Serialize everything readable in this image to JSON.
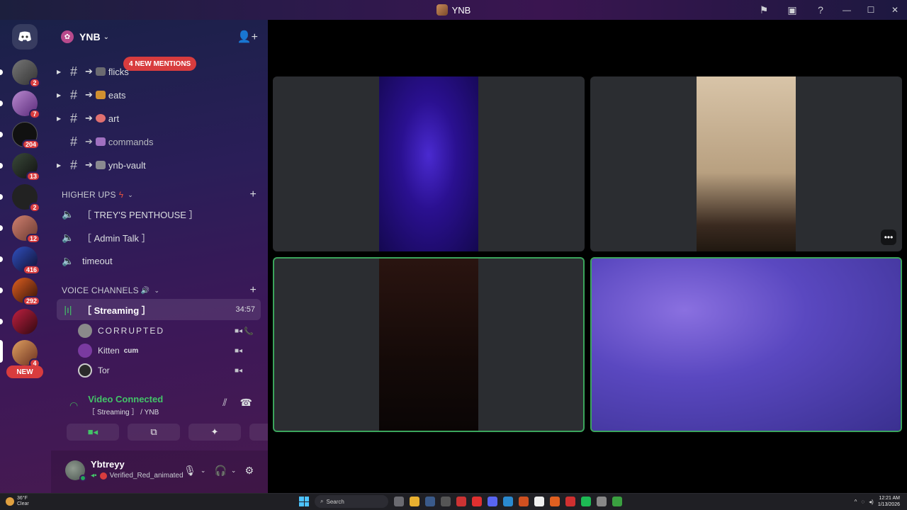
{
  "window": {
    "title": "YNB",
    "controls": [
      "flag-icon",
      "inbox-icon",
      "help-icon",
      "minimize-icon",
      "maximize-icon",
      "close-icon"
    ]
  },
  "rail": {
    "badges": [
      "2",
      "7",
      "204",
      "13",
      "2",
      "12",
      "416",
      "292",
      "4"
    ],
    "new_label": "NEW"
  },
  "server": {
    "name": "YNB",
    "mentions_label": "4 NEW MENTIONS"
  },
  "text_channels": [
    {
      "label": "flicks",
      "arrow": "➔"
    },
    {
      "label": "eats",
      "arrow": "➔"
    },
    {
      "label": "art",
      "arrow": "➔"
    },
    {
      "label": "commands",
      "arrow": "➔"
    },
    {
      "label": "ynb-vault",
      "arrow": "➔"
    }
  ],
  "categories": {
    "higher_ups": "HIGHER UPS",
    "voice_channels": "VOICE CHANNELS"
  },
  "higher_ups_channels": [
    {
      "label": "［ TREY'S PENTHOUSE ］"
    },
    {
      "label": "［ Admin Talk ］"
    },
    {
      "label": "timeout"
    }
  ],
  "voice_channel": {
    "label": "［ Streaming ］",
    "elapsed": "34:57",
    "members": [
      {
        "name": "CORRUPTED",
        "tag": ""
      },
      {
        "name": "Kitten",
        "tag": "cum"
      },
      {
        "name": "Tor",
        "tag": ""
      }
    ]
  },
  "voice_panel": {
    "status": "Video Connected",
    "location": "［ Streaming ］ / YNB"
  },
  "user": {
    "name": "Ybtreyy",
    "status_text": "Verified_Red_animated"
  },
  "taskbar": {
    "weather_temp": "36°F",
    "weather_desc": "Clear",
    "search_placeholder": "Search",
    "time": "12:21 AM",
    "date": "1/13/2026"
  },
  "colors": {
    "accent_green": "#3ba55c",
    "mention_red": "#d83c3e",
    "connected_green": "#43c468"
  }
}
